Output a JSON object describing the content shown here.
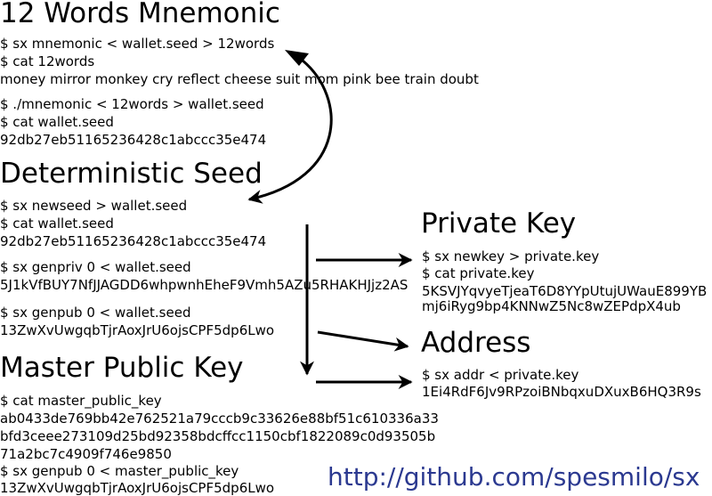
{
  "mnemonic": {
    "heading": "12 Words Mnemonic",
    "lines": [
      "$ sx mnemonic < wallet.seed > 12words",
      "$ cat 12words",
      "money mirror monkey cry reflect cheese suit mom pink bee train doubt",
      "$ ./mnemonic < 12words > wallet.seed",
      "$ cat wallet.seed",
      "92db27eb51165236428c1abccc35e474"
    ]
  },
  "seed": {
    "heading": "Deterministic Seed",
    "lines": [
      "$ sx newseed > wallet.seed",
      "$ cat wallet.seed",
      "92db27eb51165236428c1abccc35e474",
      "$ sx genpriv 0 < wallet.seed",
      "5J1kVfBUY7NfJJAGDD6whpwnhEheF9Vmh5AZu5RHAKHJjz2AS",
      "$ sx genpub 0 < wallet.seed",
      "13ZwXvUwgqbTjrAoxJrU6ojsCPF5dp6Lwo"
    ]
  },
  "master": {
    "heading": "Master Public Key",
    "lines": [
      "$ cat master_public_key",
      "ab0433de769bb42e762521a79cccb9c33626e88bf51c610336a33",
      "bfd3ceee273109d25bd92358bdcffcc1150cbf1822089c0d93505b",
      "71a2bc7c4909f746e9850",
      "$ sx genpub 0 < master_public_key",
      "13ZwXvUwgqbTjrAoxJrU6ojsCPF5dp6Lwo"
    ]
  },
  "private_key": {
    "heading": "Private Key",
    "lines": [
      "$ sx newkey > private.key",
      "$ cat private.key",
      "5KSVJYqvyeTjeaT6D8YYpUtujUWauE899YBmj6iRyg9bp4KNNwZ5Nc8wZEPdpX4ub"
    ]
  },
  "address": {
    "heading": "Address",
    "lines": [
      "$ sx addr < private.key",
      "1Ei4RdF6Jv9RPzoiBNbqxuDXuxB6HQ3R9s"
    ]
  },
  "footer": {
    "url": "http://github.com/spesmilo/sx"
  }
}
